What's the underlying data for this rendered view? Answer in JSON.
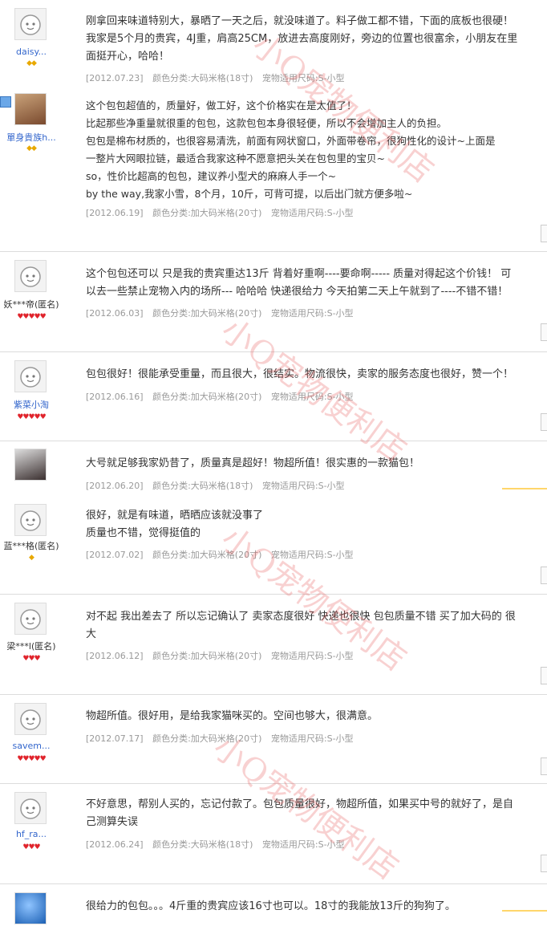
{
  "watermark": "小Q宠物便利店",
  "reviews": [
    {
      "user": "daisy...",
      "badge": "◆◆",
      "lines": [
        "刚拿回来味道特别大，暴晒了一天之后，就没味道了。料子做工都不错，下面的底板也很硬！",
        "我家是5个月的贵宾，4J重，肩高25CM，放进去高度刚好，旁边的位置也很富余，小朋友在里",
        "面挺开心，哈哈！"
      ],
      "date": "[2012.07.23]",
      "color": "颜色分类:大码米格(18寸)",
      "size": "宠物适用尺码:S-小型"
    },
    {
      "user": "單身貴族h...",
      "badge": "◆◆",
      "lines": [
        "这个包包超值的，质量好，做工好，这个价格实在是太值了！",
        "比起那些净重量就很重的包包，这款包包本身很轻便，所以不会增加主人的负担。",
        "包包是棉布材质的，也很容易清洗，前面有网状窗口，外面带卷帘，很狗性化的设计~上面是",
        "一整片大网眼拉链，最适合我家这种不愿意把头关在包包里的宝贝~",
        "so，性价比超高的包包，建议养小型犬的麻麻人手一个~",
        "by the way,我家小雪，8个月，10斤，可背可提，以后出门就方便多啦~"
      ],
      "date": "[2012.06.19]",
      "color": "颜色分类:加大码米格(20寸)",
      "size": "宠物适用尺码:S-小型"
    },
    {
      "user": "妖***帝(匿名)",
      "badge": "♥♥♥♥♥",
      "lines": [
        "这个包包还可以 只是我的贵宾重达13斤 背着好重啊----要命啊----- 质量对得起这个价钱！ 可",
        "以去一些禁止宠物入内的场所--- 哈哈哈 快递很给力 今天拍第二天上午就到了----不错不错！"
      ],
      "date": "[2012.06.03]",
      "color": "颜色分类:加大码米格(20寸)",
      "size": "宠物适用尺码:S-小型"
    },
    {
      "user": "紫菜小淘",
      "badge": "♥♥♥♥♥",
      "lines": [
        "包包很好！很能承受重量，而且很大，很结实。物流很快，卖家的服务态度也很好，赞一个！"
      ],
      "date": "[2012.06.16]",
      "color": "颜色分类:加大码米格(20寸)",
      "size": "宠物适用尺码:S-小型"
    },
    {
      "user": "",
      "badge": "",
      "lines": [
        "大号就足够我家奶昔了，质量真是超好！物超所值！很实惠的一款猫包！"
      ],
      "date": "[2012.06.20]",
      "color": "颜色分类:大码米格(18寸)",
      "size": "宠物适用尺码:S-小型"
    },
    {
      "user": "蓝***格(匿名)",
      "badge": "◆",
      "lines": [
        "很好，就是有味道，晒晒应该就没事了",
        "质量也不错，觉得挺值的"
      ],
      "date": "[2012.07.02]",
      "color": "颜色分类:加大码米格(20寸)",
      "size": "宠物适用尺码:S-小型"
    },
    {
      "user": "梁***l(匿名)",
      "badge": "♥♥♥",
      "lines": [
        "对不起 我出差去了 所以忘记确认了 卖家态度很好 快递也很快 包包质量不错 买了加大码的 很",
        "大"
      ],
      "date": "[2012.06.12]",
      "color": "颜色分类:加大码米格(20寸)",
      "size": "宠物适用尺码:S-小型"
    },
    {
      "user": "savem...",
      "badge": "♥♥♥♥♥",
      "lines": [
        "物超所值。很好用，是给我家猫咪买的。空间也够大，很满意。"
      ],
      "date": "[2012.07.17]",
      "color": "颜色分类:加大码米格(20寸)",
      "size": "宠物适用尺码:S-小型"
    },
    {
      "user": "hf_ra...",
      "badge": "♥♥♥",
      "lines": [
        "不好意思，帮别人买的，忘记付款了。包包质量很好，物超所值，如果买中号的就好了，是自",
        "己测算失误"
      ],
      "date": "[2012.06.24]",
      "color": "颜色分类:大码米格(18寸)",
      "size": "宠物适用尺码:S-小型"
    },
    {
      "user": "",
      "badge": "",
      "lines": [
        "很给力的包包。。。4斤重的贵宾应该16寸也可以。18寸的我能放13斤的狗狗了。"
      ],
      "date": "",
      "color": "",
      "size": ""
    }
  ]
}
